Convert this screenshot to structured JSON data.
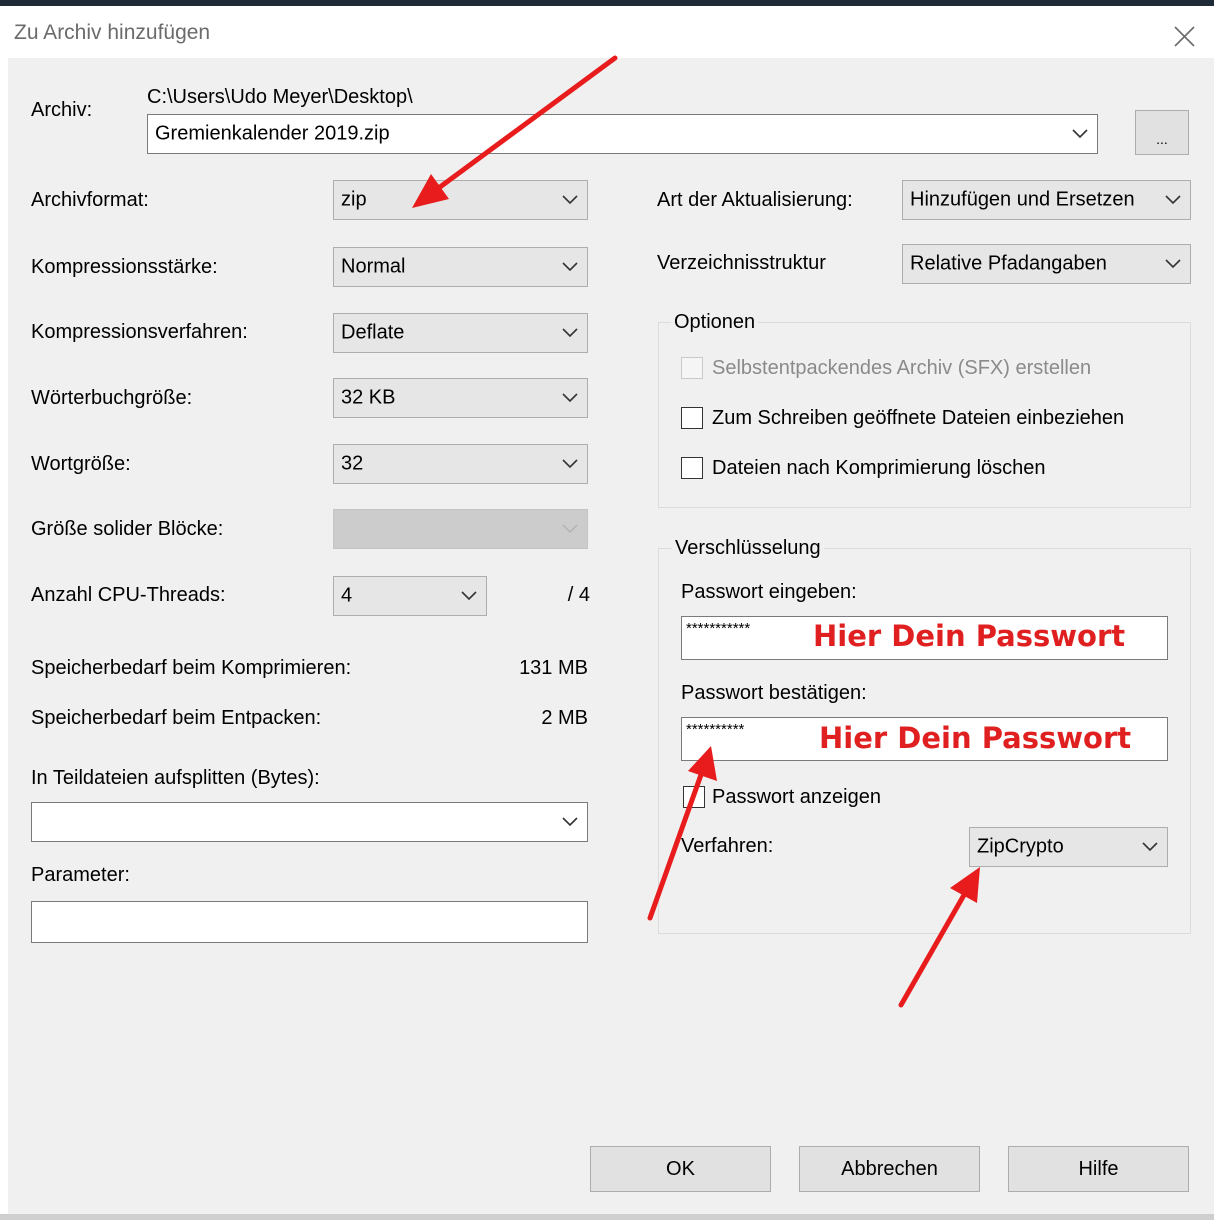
{
  "window": {
    "title": "Zu Archiv hinzufügen",
    "close_glyph": "✕"
  },
  "archive": {
    "label": "Archiv:",
    "path": "C:\\Users\\Udo Meyer\\Desktop\\",
    "filename": "Gremienkalender 2019.zip",
    "browse_label": "..."
  },
  "left": {
    "format_label": "Archivformat:",
    "format_value": "zip",
    "level_label": "Kompressionsstärke:",
    "level_value": "Normal",
    "method_label": "Kompressionsverfahren:",
    "method_value": "Deflate",
    "dict_label": "Wörterbuchgröße:",
    "dict_value": "32 KB",
    "word_label": "Wortgröße:",
    "word_value": "32",
    "solid_label": "Größe solider Blöcke:",
    "solid_value": "",
    "threads_label": "Anzahl CPU-Threads:",
    "threads_value": "4",
    "threads_max": "/ 4",
    "mem_compress_label": "Speicherbedarf beim Komprimieren:",
    "mem_compress_value": "131 MB",
    "mem_extract_label": "Speicherbedarf beim Entpacken:",
    "mem_extract_value": "2 MB",
    "split_label": "In Teildateien aufsplitten (Bytes):",
    "split_value": "",
    "params_label": "Parameter:",
    "params_value": ""
  },
  "right": {
    "update_label": "Art der Aktualisierung:",
    "update_value": "Hinzufügen und Ersetzen",
    "paths_label": "Verzeichnisstruktur",
    "paths_value": "Relative Pfadangaben"
  },
  "options": {
    "title": "Optionen",
    "sfx_label": "Selbstentpackendes Archiv (SFX) erstellen",
    "shared_label": "Zum Schreiben geöffnete Dateien einbeziehen",
    "delete_label": "Dateien nach Komprimierung löschen"
  },
  "encryption": {
    "title": "Verschlüsselung",
    "enter_label": "Passwort eingeben:",
    "enter_dots": "***********",
    "enter_annotation": "Hier Dein Passwort",
    "confirm_label": "Passwort bestätigen:",
    "confirm_dots": "**********",
    "confirm_annotation": "Hier Dein Passwort",
    "show_label": "Passwort anzeigen",
    "method_label": "Verfahren:",
    "method_value": "ZipCrypto"
  },
  "buttons": {
    "ok": "OK",
    "cancel": "Abbrechen",
    "help": "Hilfe"
  },
  "colors": {
    "dialog_bg": "#f0f0f0",
    "annotation_red": "#e02020"
  }
}
